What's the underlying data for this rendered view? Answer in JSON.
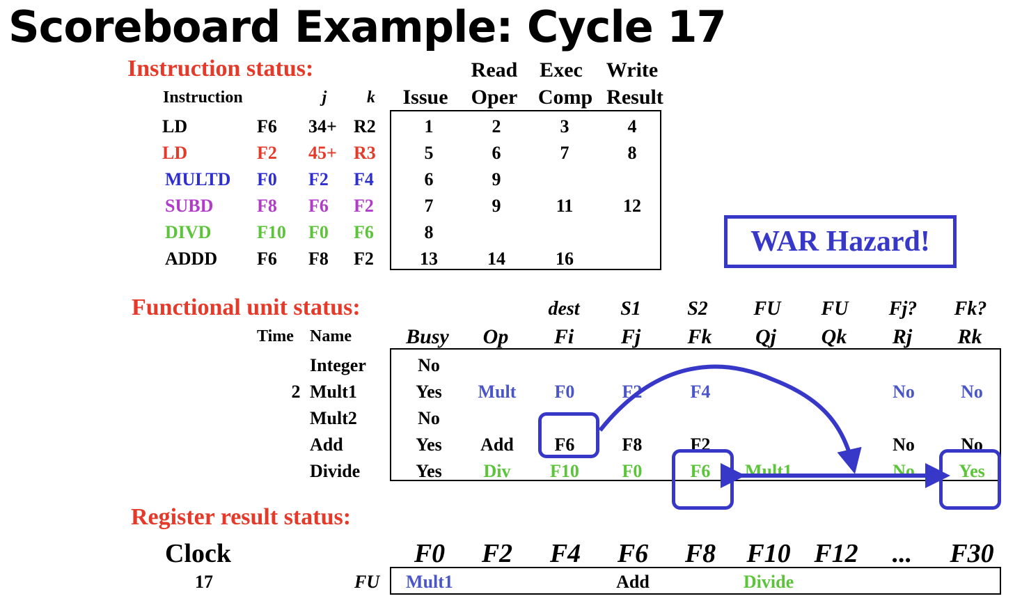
{
  "title": "Scoreboard Example: Cycle 17",
  "colors": {
    "red": "#e53a2a",
    "blue": "#2f2fd0",
    "muted_blue": "#4a55c8",
    "purple": "#b03cc8",
    "green": "#5cc43a",
    "black": "#000000",
    "highlight": "#3838c8"
  },
  "instruction_status": {
    "label": "Instruction status:",
    "headers": {
      "instruction": "Instruction",
      "j": "j",
      "k": "k",
      "issue": "Issue",
      "read_top": "Read",
      "read_bottom": "Oper",
      "exec_top": "Exec",
      "exec_bottom": "Comp",
      "write_top": "Write",
      "write_bottom": "Result"
    },
    "rows": [
      {
        "op": "LD",
        "dest": "F6",
        "j": "34+",
        "k": "R2",
        "issue": "1",
        "read": "2",
        "exec": "3",
        "write": "4",
        "color": "black"
      },
      {
        "op": "LD",
        "dest": "F2",
        "j": "45+",
        "k": "R3",
        "issue": "5",
        "read": "6",
        "exec": "7",
        "write": "8",
        "color": "red"
      },
      {
        "op": "MULTD",
        "dest": "F0",
        "j": "F2",
        "k": "F4",
        "issue": "6",
        "read": "9",
        "exec": "",
        "write": "",
        "color": "blue"
      },
      {
        "op": "SUBD",
        "dest": "F8",
        "j": "F6",
        "k": "F2",
        "issue": "7",
        "read": "9",
        "exec": "11",
        "write": "12",
        "color": "purple"
      },
      {
        "op": "DIVD",
        "dest": "F10",
        "j": "F0",
        "k": "F6",
        "issue": "8",
        "read": "",
        "exec": "",
        "write": "",
        "color": "green"
      },
      {
        "op": "ADDD",
        "dest": "F6",
        "j": "F8",
        "k": "F2",
        "issue": "13",
        "read": "14",
        "exec": "16",
        "write": "",
        "color": "black"
      }
    ]
  },
  "war_hazard": "WAR Hazard!",
  "functional_unit_status": {
    "label": "Functional unit status:",
    "headers": {
      "time": "Time",
      "name": "Name",
      "busy": "Busy",
      "op": "Op",
      "fi_top": "dest",
      "fi": "Fi",
      "fj_top": "S1",
      "fj": "Fj",
      "fk_top": "S2",
      "fk": "Fk",
      "qj_top": "FU",
      "qj": "Qj",
      "qk_top": "FU",
      "qk": "Qk",
      "rj_top": "Fj?",
      "rj": "Rj",
      "rk_top": "Fk?",
      "rk": "Rk"
    },
    "rows": [
      {
        "time": "",
        "name": "Integer",
        "busy": "No",
        "op": "",
        "fi": "",
        "fj": "",
        "fk": "",
        "qj": "",
        "qk": "",
        "rj": "",
        "rk": "",
        "color": "black"
      },
      {
        "time": "2",
        "name": "Mult1",
        "busy": "Yes",
        "op": "Mult",
        "fi": "F0",
        "fj": "F2",
        "fk": "F4",
        "qj": "",
        "qk": "",
        "rj": "No",
        "rk": "No",
        "color": "muted_blue"
      },
      {
        "time": "",
        "name": "Mult2",
        "busy": "No",
        "op": "",
        "fi": "",
        "fj": "",
        "fk": "",
        "qj": "",
        "qk": "",
        "rj": "",
        "rk": "",
        "color": "black"
      },
      {
        "time": "",
        "name": "Add",
        "busy": "Yes",
        "op": "Add",
        "fi": "F6",
        "fj": "F8",
        "fk": "F2",
        "qj": "",
        "qk": "",
        "rj": "No",
        "rk": "No",
        "color": "black"
      },
      {
        "time": "",
        "name": "Divide",
        "busy": "Yes",
        "op": "Div",
        "fi": "F10",
        "fj": "F0",
        "fk": "F6",
        "qj": "Mult1",
        "qk": "",
        "rj": "No",
        "rk": "Yes",
        "color": "green"
      }
    ]
  },
  "register_result_status": {
    "label": "Register result status:",
    "clock_label": "Clock",
    "clock_value": "17",
    "fu_label": "FU",
    "registers": [
      "F0",
      "F2",
      "F4",
      "F6",
      "F8",
      "F10",
      "F12",
      "...",
      "F30"
    ],
    "values": [
      {
        "text": "Mult1",
        "color": "muted_blue"
      },
      {
        "text": "",
        "color": "black"
      },
      {
        "text": "",
        "color": "black"
      },
      {
        "text": "Add",
        "color": "black"
      },
      {
        "text": "",
        "color": "black"
      },
      {
        "text": "Divide",
        "color": "green"
      },
      {
        "text": "",
        "color": "black"
      },
      {
        "text": "",
        "color": "black"
      },
      {
        "text": "",
        "color": "black"
      }
    ]
  }
}
